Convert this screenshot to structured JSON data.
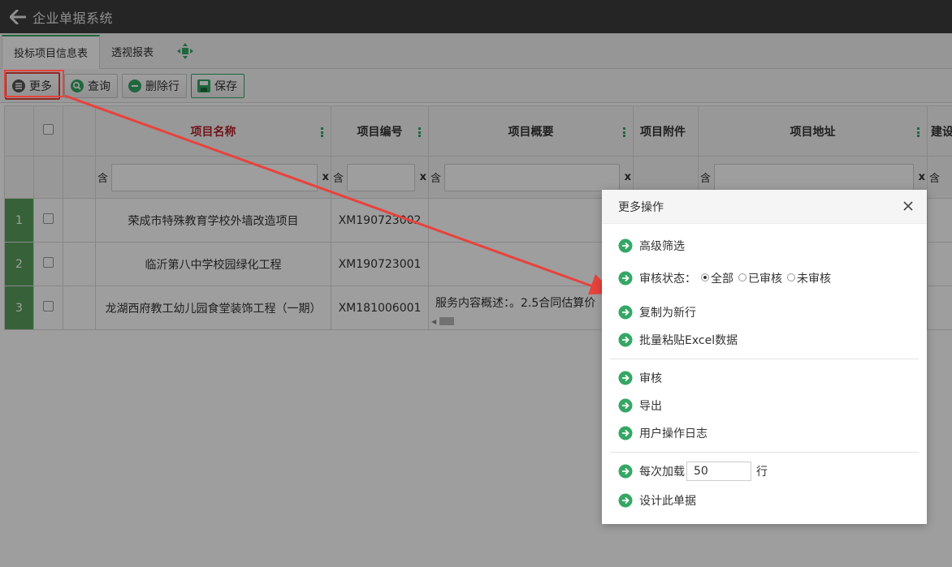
{
  "app": {
    "title": "企业单据系统"
  },
  "tabs": [
    {
      "label": "投标项目信息表",
      "active": true
    },
    {
      "label": "透视报表",
      "active": false
    }
  ],
  "toolbar": {
    "more": "更多",
    "query": "查询",
    "delete_row": "删除行",
    "save": "保存"
  },
  "grid": {
    "columns": [
      "项目名称",
      "项目编号",
      "项目概要",
      "项目附件",
      "项目地址",
      "建设"
    ],
    "filter_prefix": "含",
    "filter_clear": "x",
    "rows": [
      {
        "num": "1",
        "name": "荣成市特殊教育学校外墙改造项目",
        "code": "XM190723002",
        "summary": ""
      },
      {
        "num": "2",
        "name": "临沂第八中学校园绿化工程",
        "code": "XM190723001",
        "summary": ""
      },
      {
        "num": "3",
        "name": "龙湖西府教工幼儿园食堂装饰工程（一期）",
        "code": "XM181006001",
        "summary": "服务内容概述：。2.5合同估算价"
      }
    ]
  },
  "dialog": {
    "title": "更多操作",
    "items": {
      "advanced_filter": "高级筛选",
      "audit_status_label": "审核状态：",
      "audit_all": "全部",
      "audit_done": "已审核",
      "audit_pending": "未审核",
      "copy_new_row": "复制为新行",
      "paste_excel": "批量粘贴Excel数据",
      "audit": "审核",
      "export": "导出",
      "user_log": "用户操作日志",
      "per_load_label": "每次加载",
      "per_load_value": "50",
      "per_load_unit": "行",
      "design": "设计此单据"
    }
  },
  "colors": {
    "accent_green": "#35a765",
    "highlight_red": "#e8423c",
    "title_bg": "#3c3c3c"
  }
}
